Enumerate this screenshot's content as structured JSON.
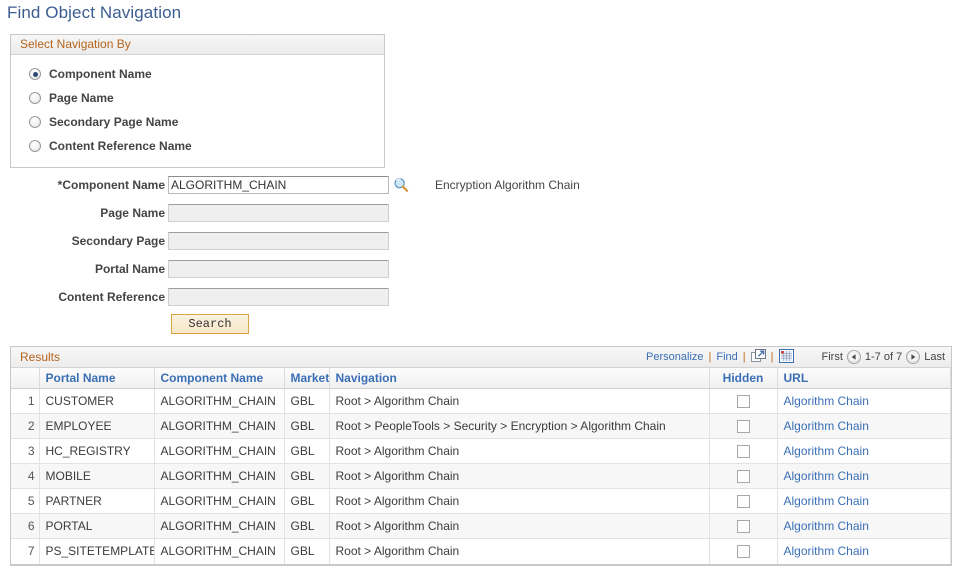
{
  "page": {
    "title": "Find Object Navigation"
  },
  "navigation_group": {
    "header": "Select Navigation By",
    "options": [
      {
        "label": "Component Name",
        "selected": true
      },
      {
        "label": "Page Name",
        "selected": false
      },
      {
        "label": "Secondary Page Name",
        "selected": false
      },
      {
        "label": "Content Reference Name",
        "selected": false
      }
    ]
  },
  "form": {
    "fields": [
      {
        "label": "*Component Name",
        "value": "ALGORITHM_CHAIN",
        "placeholder": "",
        "disabled": false,
        "has_lookup": true,
        "description": "Encryption Algorithm Chain"
      },
      {
        "label": "Page Name",
        "value": "",
        "placeholder": "",
        "disabled": true,
        "has_lookup": false,
        "description": ""
      },
      {
        "label": "Secondary Page",
        "value": "",
        "placeholder": "",
        "disabled": true,
        "has_lookup": false,
        "description": ""
      },
      {
        "label": "Portal Name",
        "value": "",
        "placeholder": "",
        "disabled": true,
        "has_lookup": false,
        "description": ""
      },
      {
        "label": "Content Reference",
        "value": "",
        "placeholder": "",
        "disabled": true,
        "has_lookup": false,
        "description": ""
      }
    ],
    "search_button": "Search"
  },
  "results": {
    "title": "Results",
    "toolbar": {
      "personalize": "Personalize",
      "find": "Find",
      "separator": "|",
      "export_icon": "new-window-icon",
      "grid_icon": "download-spreadsheet-icon"
    },
    "pager": {
      "first": "First",
      "range": "1-7 of 7",
      "last": "Last",
      "prev_icon": "previous-page-icon",
      "next_icon": "next-page-icon"
    },
    "columns": [
      {
        "key": "num",
        "label": "",
        "class": "col-num"
      },
      {
        "key": "portal",
        "label": "Portal Name",
        "class": "col-portal"
      },
      {
        "key": "component",
        "label": "Component Name",
        "class": "col-comp"
      },
      {
        "key": "market",
        "label": "Market",
        "class": "col-market"
      },
      {
        "key": "navigation",
        "label": "Navigation",
        "class": "col-nav"
      },
      {
        "key": "hidden",
        "label": "Hidden",
        "class": "col-hidden"
      },
      {
        "key": "url",
        "label": "URL",
        "class": "col-url"
      }
    ],
    "rows": [
      {
        "num": "1",
        "portal": "CUSTOMER",
        "component": "ALGORITHM_CHAIN",
        "market": "GBL",
        "navigation": "Root > Algorithm Chain",
        "hidden": false,
        "url": "Algorithm Chain"
      },
      {
        "num": "2",
        "portal": "EMPLOYEE",
        "component": "ALGORITHM_CHAIN",
        "market": "GBL",
        "navigation": "Root > PeopleTools > Security > Encryption > Algorithm Chain",
        "hidden": false,
        "url": "Algorithm Chain"
      },
      {
        "num": "3",
        "portal": "HC_REGISTRY",
        "component": "ALGORITHM_CHAIN",
        "market": "GBL",
        "navigation": "Root > Algorithm Chain",
        "hidden": false,
        "url": "Algorithm Chain"
      },
      {
        "num": "4",
        "portal": "MOBILE",
        "component": "ALGORITHM_CHAIN",
        "market": "GBL",
        "navigation": "Root > Algorithm Chain",
        "hidden": false,
        "url": "Algorithm Chain"
      },
      {
        "num": "5",
        "portal": "PARTNER",
        "component": "ALGORITHM_CHAIN",
        "market": "GBL",
        "navigation": "Root > Algorithm Chain",
        "hidden": false,
        "url": "Algorithm Chain"
      },
      {
        "num": "6",
        "portal": "PORTAL",
        "component": "ALGORITHM_CHAIN",
        "market": "GBL",
        "navigation": "Root > Algorithm Chain",
        "hidden": false,
        "url": "Algorithm Chain"
      },
      {
        "num": "7",
        "portal": "PS_SITETEMPLATE",
        "component": "ALGORITHM_CHAIN",
        "market": "GBL",
        "navigation": "Root > Algorithm Chain",
        "hidden": false,
        "url": "Algorithm Chain"
      }
    ]
  },
  "colors": {
    "title_blue": "#3b5d8f",
    "group_header_orange": "#b5631c",
    "link_blue": "#3a6fb5",
    "button_border": "#d9a441",
    "radio_dot": "#2b4a73"
  }
}
